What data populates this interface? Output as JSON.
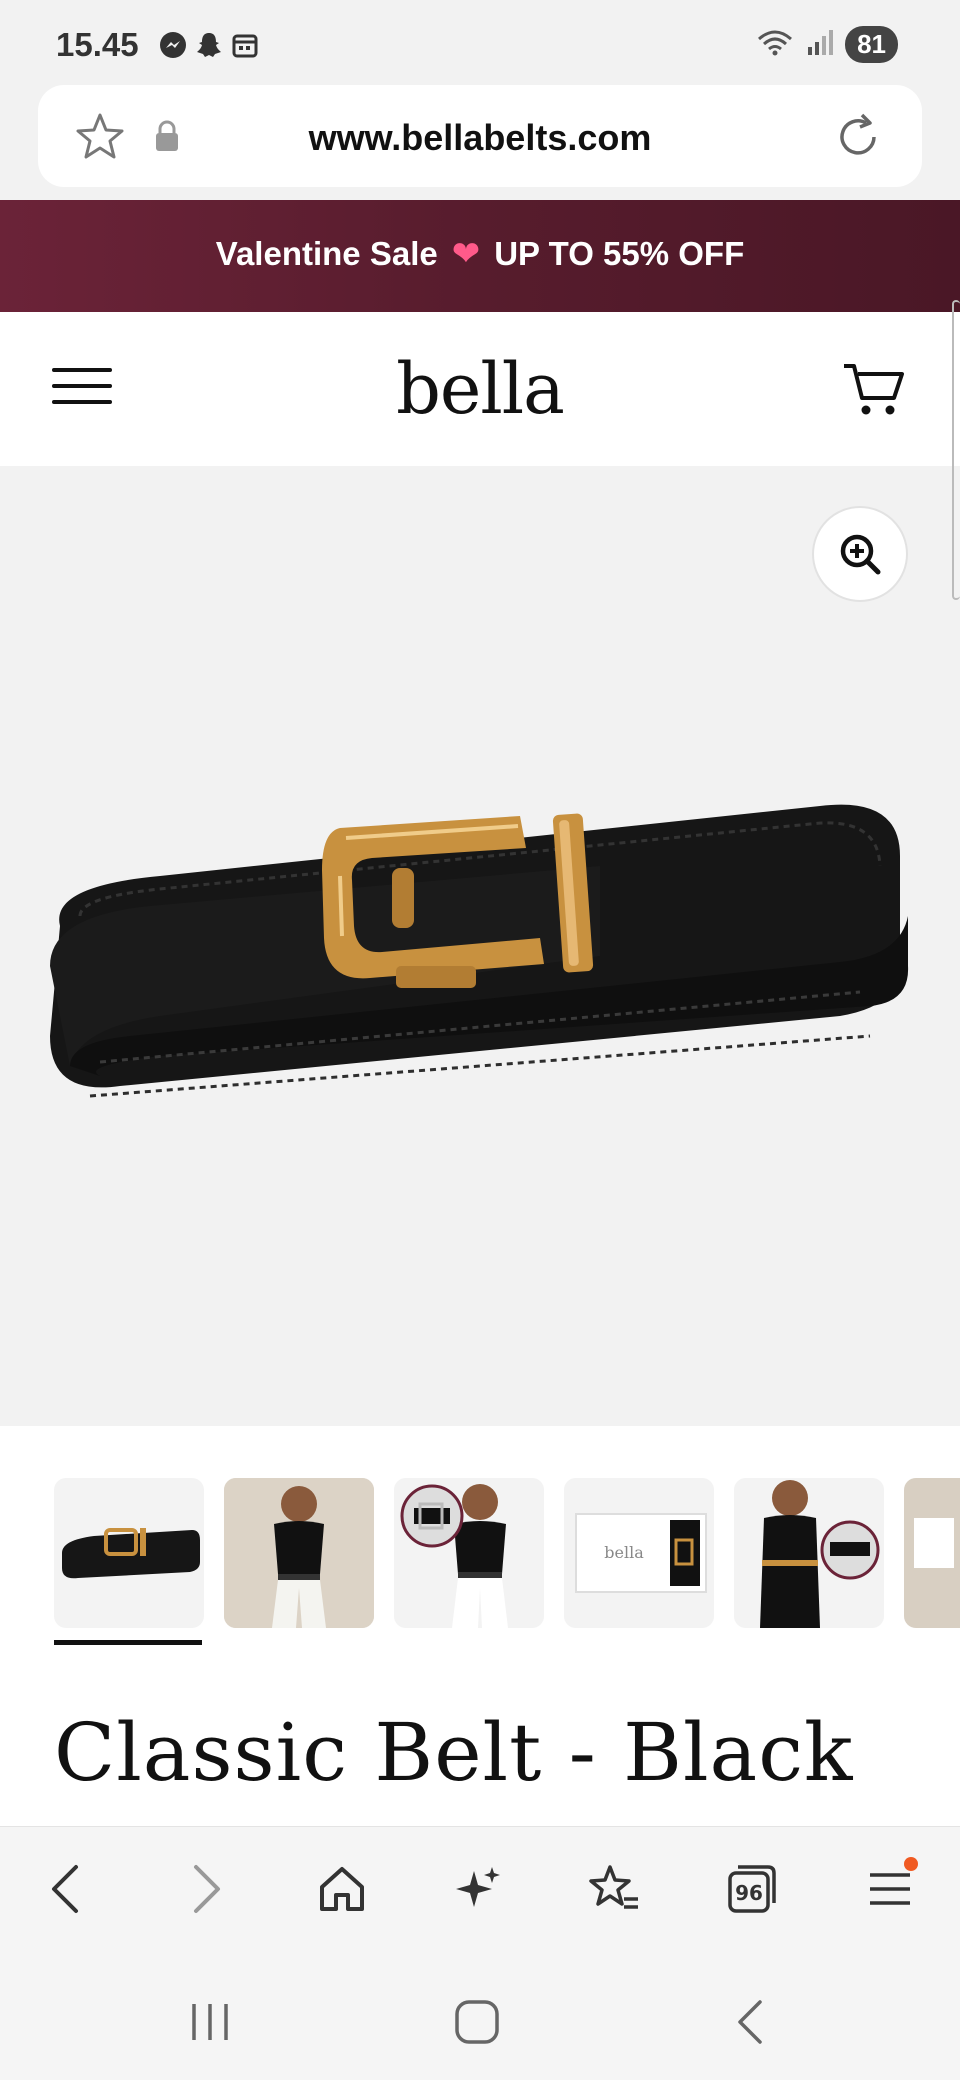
{
  "status_bar": {
    "time": "15.45",
    "battery": "81",
    "icons": [
      "messenger-icon",
      "snapchat-icon",
      "calendar-icon",
      "wifi-icon",
      "signal-icon"
    ]
  },
  "url_bar": {
    "url": "www.bellabelts.com"
  },
  "promo": {
    "left_text": "Valentine Sale",
    "right_text": "UP TO 55% OFF",
    "heart": "❤"
  },
  "header": {
    "logo": "bella"
  },
  "product": {
    "title": "Classic Belt - Black",
    "thumbnails": [
      {
        "name": "thumb-belt-product"
      },
      {
        "name": "thumb-model-front"
      },
      {
        "name": "thumb-model-buckle-detail"
      },
      {
        "name": "thumb-gift-box"
      },
      {
        "name": "thumb-model-belt-closeup"
      },
      {
        "name": "thumb-model-box"
      }
    ],
    "thumbnail_box_text": "bella"
  },
  "browser_nav": {
    "tab_count": "96",
    "items": [
      "back-icon",
      "forward-icon",
      "home-icon",
      "sparkle-icon",
      "bookmark-star-icon",
      "tabs-icon",
      "menu-icon"
    ]
  },
  "colors": {
    "promo_bg": "#571c2d",
    "accent_dot": "#f05a22",
    "gold": "#c8913f"
  }
}
